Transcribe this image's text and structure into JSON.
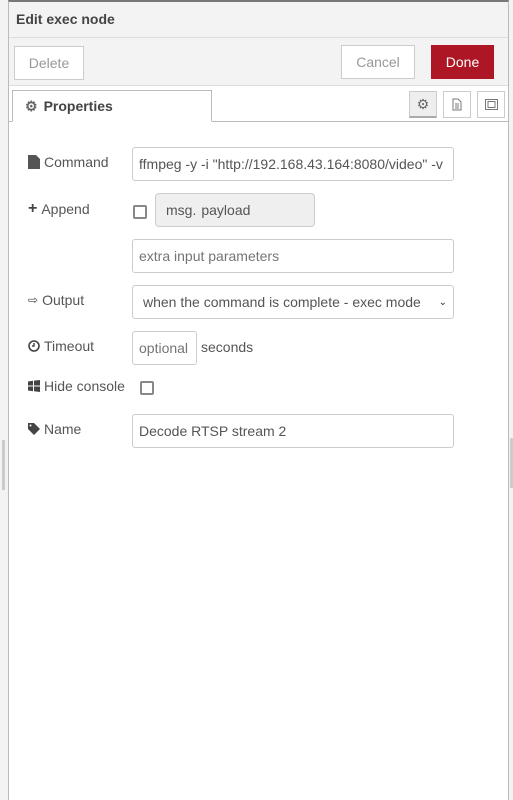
{
  "header": {
    "title": "Edit exec node"
  },
  "toolbar": {
    "delete": "Delete",
    "cancel": "Cancel",
    "done": "Done",
    "done_color": "#ad1625"
  },
  "tabs": {
    "properties": "Properties"
  },
  "form": {
    "command": {
      "label": "Command",
      "value": "ffmpeg  -y -i \"http://192.168.43.164:8080/video\" -v"
    },
    "append": {
      "label": "Append",
      "checked": false,
      "msg_prefix": "msg.",
      "msg_field": "payload",
      "extra_placeholder": "extra input parameters"
    },
    "output": {
      "label": "Output",
      "value": "when the command is complete - exec mode"
    },
    "timeout": {
      "label": "Timeout",
      "placeholder": "optional",
      "unit": "seconds"
    },
    "hide_console": {
      "label": "Hide console",
      "checked": false
    },
    "name": {
      "label": "Name",
      "value": "Decode RTSP stream 2"
    }
  }
}
